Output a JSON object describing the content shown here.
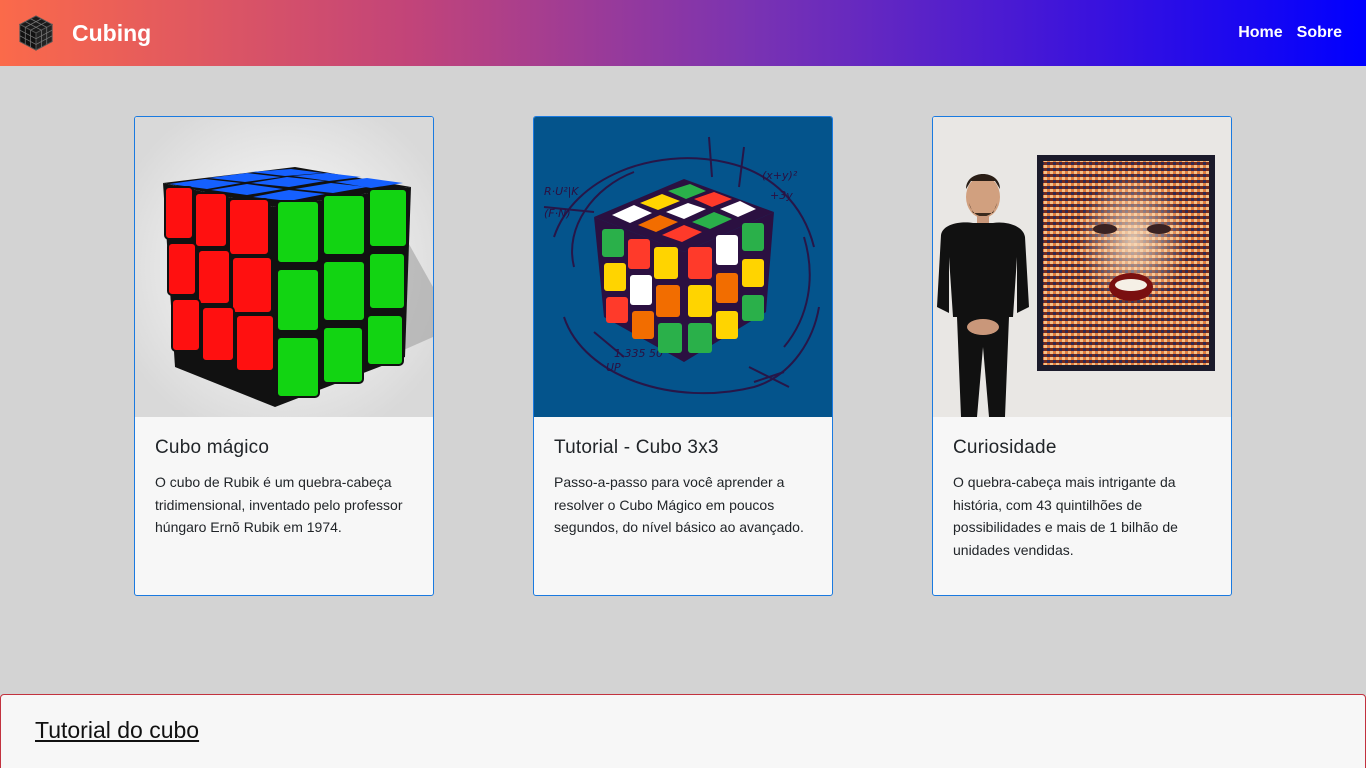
{
  "navbar": {
    "brand": "Cubing",
    "links": [
      {
        "label": "Home"
      },
      {
        "label": "Sobre"
      }
    ],
    "gradient_start": "#fb6a4a",
    "gradient_end": "#0000ff"
  },
  "cards": [
    {
      "title": "Cubo mágico",
      "text": "O cubo de Rubik é um quebra-cabeça tridimensional, inventado pelo professor húngaro Ernõ Rubik em 1974.",
      "image": "rubiks-cube-3d-illustration"
    },
    {
      "title": "Tutorial - Cubo 3x3",
      "text": "Passo-a-passo para você aprender a resolver o Cubo Mágico em poucos segundos, do nível básico ao avançado.",
      "image": "sketched-rubiks-cube-with-formulas"
    },
    {
      "title": "Curiosidade",
      "text": "O quebra-cabeça mais intrigante da história, com 43 quintilhões de possibilidades e mais de 1 bilhão de unidades vendidas.",
      "image": "man-beside-rubiks-cube-mosaic-portrait"
    }
  ],
  "tutorial_section": {
    "title": "Tutorial do cubo"
  },
  "colors": {
    "page_background": "#d3d3d3",
    "card_border": "#1a7ae0",
    "section_border": "#c2323f"
  }
}
